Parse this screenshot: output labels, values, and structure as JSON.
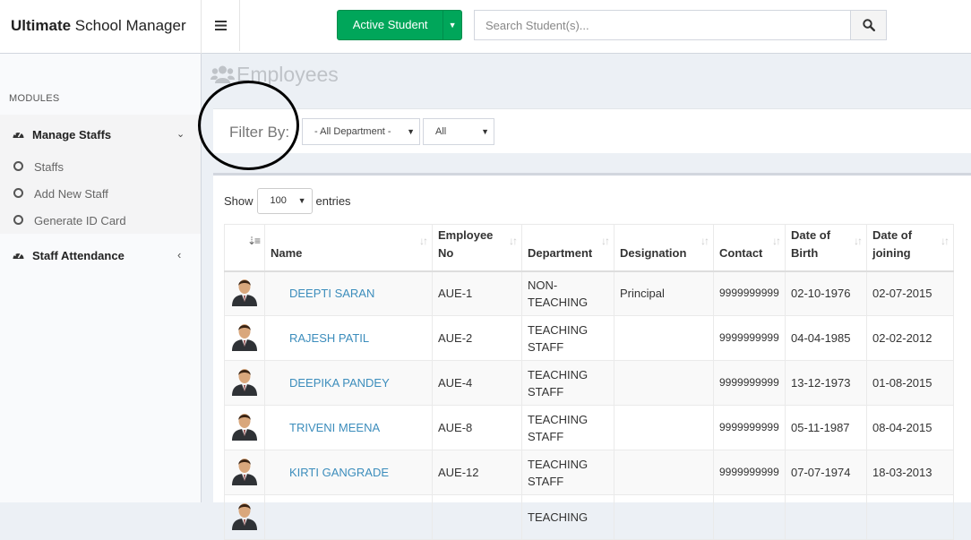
{
  "app": {
    "title_bold": "Ultimate",
    "title_rest": " School Manager"
  },
  "header": {
    "active_button_label": "Active Student",
    "search_placeholder": "Search Student(s)..."
  },
  "sidebar": {
    "section_label": "MODULES",
    "menu_open": {
      "label": "Manage Staffs",
      "icon": "dashboard-icon",
      "items": [
        {
          "label": "Staffs"
        },
        {
          "label": "Add New Staff"
        },
        {
          "label": "Generate ID Card"
        }
      ]
    },
    "menu_closed": {
      "label": "Staff Attendance",
      "icon": "dashboard-icon"
    }
  },
  "page": {
    "title": "Employees"
  },
  "filter": {
    "label": "Filter By:",
    "department_value": "- All Department -",
    "type_value": "All"
  },
  "table": {
    "show_label": "Show",
    "entries_value": "100",
    "entries_label": "entries",
    "columns": [
      {
        "line1": "",
        "line2": ""
      },
      {
        "line1": "",
        "line2": "Name"
      },
      {
        "line1": "Employee",
        "line2": "No"
      },
      {
        "line1": "",
        "line2": "Department"
      },
      {
        "line1": "",
        "line2": "Designation"
      },
      {
        "line1": "",
        "line2": "Contact"
      },
      {
        "line1": "Date of",
        "line2": "Birth"
      },
      {
        "line1": "Date of",
        "line2": "joining"
      }
    ],
    "rows": [
      {
        "name": "DEEPTI SARAN",
        "emp_no": "AUE-1",
        "dept1": "NON-TEACHING",
        "dept2": "",
        "designation": "Principal",
        "contact": "9999999999",
        "dob": "02-10-1976",
        "doj": "02-07-2015"
      },
      {
        "name": "RAJESH PATIL",
        "emp_no": "AUE-2",
        "dept1": "TEACHING",
        "dept2": "STAFF",
        "designation": "",
        "contact": "9999999999",
        "dob": "04-04-1985",
        "doj": "02-02-2012"
      },
      {
        "name": "DEEPIKA PANDEY",
        "emp_no": "AUE-4",
        "dept1": "TEACHING",
        "dept2": "STAFF",
        "designation": "",
        "contact": "9999999999",
        "dob": "13-12-1973",
        "doj": "01-08-2015"
      },
      {
        "name": "TRIVENI MEENA",
        "emp_no": "AUE-8",
        "dept1": "TEACHING",
        "dept2": "STAFF",
        "designation": "",
        "contact": "9999999999",
        "dob": "05-11-1987",
        "doj": "08-04-2015"
      },
      {
        "name": "KIRTI GANGRADE",
        "emp_no": "AUE-12",
        "dept1": "TEACHING",
        "dept2": "STAFF",
        "designation": "",
        "contact": "9999999999",
        "dob": "07-07-1974",
        "doj": "18-03-2013"
      },
      {
        "name": "",
        "emp_no": "",
        "dept1": "TEACHING",
        "dept2": "",
        "designation": "",
        "contact": "",
        "dob": "",
        "doj": ""
      }
    ]
  }
}
